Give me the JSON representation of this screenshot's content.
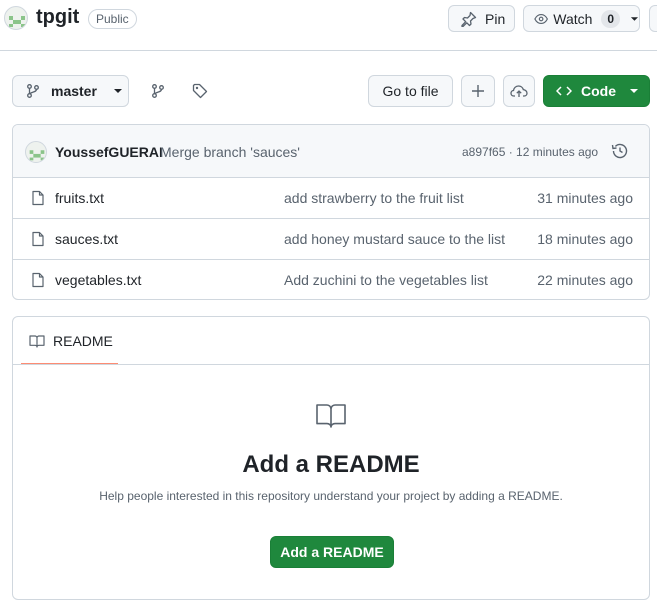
{
  "repo": {
    "name": "tpgit",
    "visibility": "Public"
  },
  "actions": {
    "pin_label": "Pin",
    "watch_label": "Watch",
    "watch_count": "0"
  },
  "toolbar": {
    "branch": "master",
    "go_to_file": "Go to file",
    "code_label": "Code"
  },
  "latest_commit": {
    "author": "YoussefGUERAI",
    "message": "Merge branch 'sauces'",
    "meta": "a897f65 · 12 minutes ago"
  },
  "files": [
    {
      "name": "fruits.txt",
      "message": "add strawberry to the fruit list",
      "time": "31 minutes ago"
    },
    {
      "name": "sauces.txt",
      "message": "add honey mustard sauce to the list",
      "time": "18 minutes ago"
    },
    {
      "name": "vegetables.txt",
      "message": "Add zuchini to the vegetables list",
      "time": "22 minutes ago"
    }
  ],
  "readme": {
    "tab_label": "README",
    "title": "Add a README",
    "description": "Help people interested in this repository understand your project by adding a README.",
    "button_label": "Add a README"
  },
  "colors": {
    "primary_green": "#1f883d",
    "border": "#d0d7de",
    "muted_text": "#59636e",
    "tab_underline": "#fd8c73"
  },
  "icons": [
    "identicon-avatar",
    "pin-icon",
    "eye-icon",
    "branch-icon",
    "branches-icon",
    "tag-icon",
    "plus-icon",
    "cloud-icon",
    "code-icon",
    "history-icon",
    "file-icon",
    "book-icon"
  ]
}
